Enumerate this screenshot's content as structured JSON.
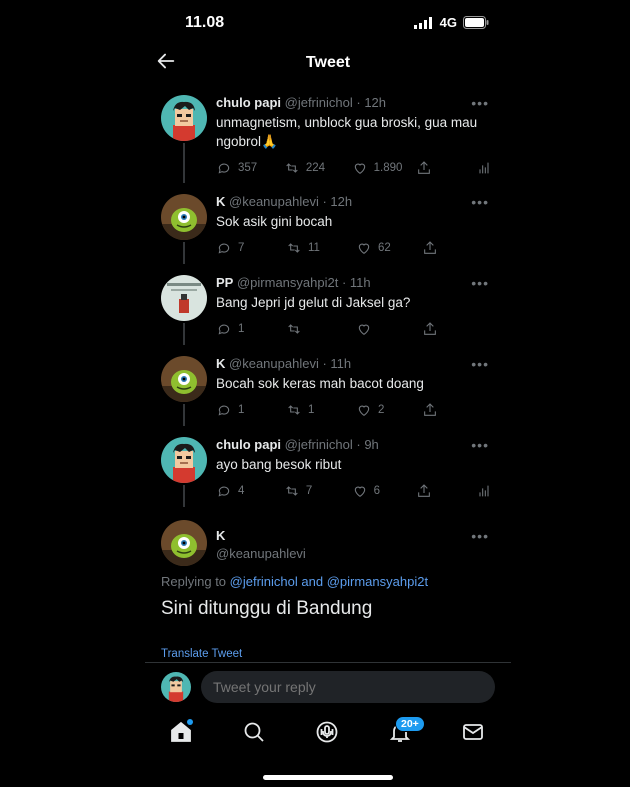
{
  "status_bar": {
    "time": "11.08",
    "network": "4G"
  },
  "header": {
    "title": "Tweet"
  },
  "tweets": [
    {
      "name": "chulo papi",
      "handle": "@jefrinichol",
      "time": "12h",
      "text": "unmagnetism, unblock gua broski, gua mau ngobrol🙏",
      "replies": "357",
      "retweets": "224",
      "likes": "1.890",
      "avatar": "chulo"
    },
    {
      "name": "K",
      "handle": "@keanupahlevi",
      "time": "12h",
      "text": "Sok asik gini bocah",
      "replies": "7",
      "retweets": "11",
      "likes": "62",
      "avatar": "green"
    },
    {
      "name": "PP",
      "handle": "@pirmansyahpi2t",
      "time": "11h",
      "text": "Bang Jepri jd gelut di Jaksel ga?",
      "replies": "1",
      "retweets": "",
      "likes": "",
      "avatar": "pp"
    },
    {
      "name": "K",
      "handle": "@keanupahlevi",
      "time": "11h",
      "text": "Bocah sok keras mah bacot doang",
      "replies": "1",
      "retweets": "1",
      "likes": "2",
      "avatar": "green"
    },
    {
      "name": "chulo papi",
      "handle": "@jefrinichol",
      "time": "9h",
      "text": "ayo bang besok ribut",
      "replies": "4",
      "retweets": "7",
      "likes": "6",
      "avatar": "chulo"
    }
  ],
  "focus_tweet": {
    "name": "K",
    "handle": "@keanupahlevi",
    "replying_prefix": "Replying to ",
    "replying_user1": "@jefrinichol",
    "replying_and": " and ",
    "replying_user2": "@pirmansyahpi2t",
    "text": "Sini ditunggu di Bandung",
    "translate": "Translate Tweet"
  },
  "reply_bar": {
    "placeholder": "Tweet your reply"
  },
  "tabbar": {
    "notification_badge": "20+"
  },
  "colors": {
    "accent": "#1d9bf0",
    "link": "#5c9ded",
    "background": "#000000"
  }
}
